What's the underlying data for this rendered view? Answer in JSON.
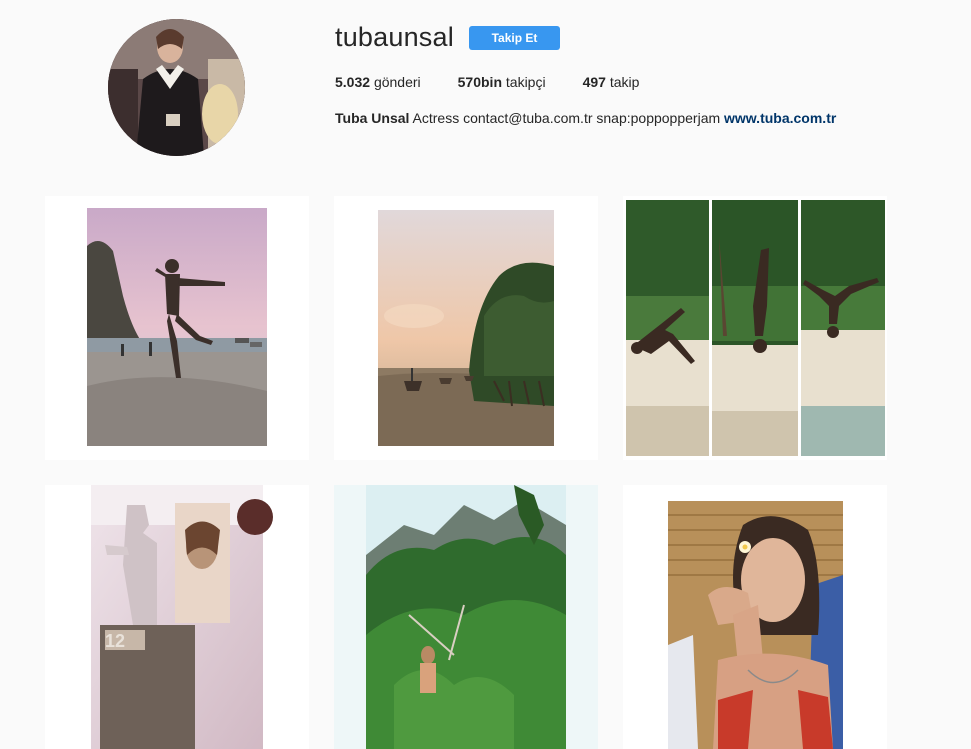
{
  "profile": {
    "username": "tubaunsal",
    "follow_label": "Takip Et",
    "stats": {
      "posts_value": "5.032",
      "posts_label": "gönderi",
      "followers_value": "570bin",
      "followers_label": "takipçi",
      "following_value": "497",
      "following_label": "takip"
    },
    "bio": {
      "name": "Tuba Unsal",
      "text": "Actress contact@tuba.com.tr snap:poppopperjam",
      "link": "www.tuba.com.tr"
    }
  },
  "colors": {
    "follow_button": "#3897f0",
    "link": "#003569",
    "background": "#fafafa"
  }
}
